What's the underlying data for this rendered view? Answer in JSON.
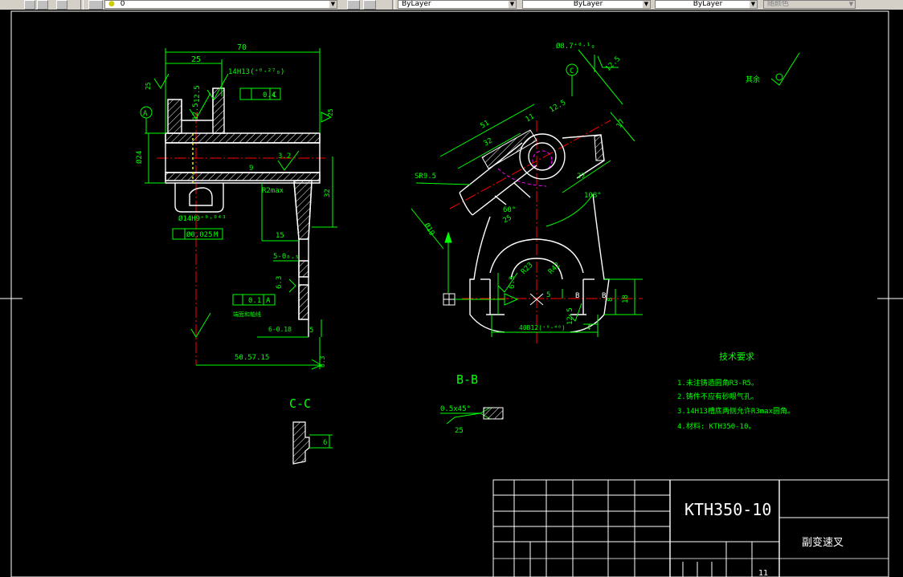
{
  "toolbar": {
    "layer_name": "0",
    "color": "ByLayer",
    "linetype": "ByLayer",
    "lineweight": "ByLayer",
    "plotstyle": "随颜色"
  },
  "drawing": {
    "left_view": {
      "dim_overall": "70",
      "dim_25": "25",
      "fit_14h13": "14H13(⁺⁰·²⁷₀)",
      "flatness_value": "0.4",
      "datum_c": "C",
      "datum_a": "A",
      "surf_12_5a": "12.5",
      "surf_12_5b": "12.5",
      "surf_3_2": "3.2",
      "dim_9": "9",
      "dia_24": "Ø24",
      "r2max": "R2max",
      "dim_32": "32",
      "bore": "Ø14H9⁺⁰·⁰⁴³",
      "position_tol": "Ø0.025",
      "modifier_m": "M",
      "dim_15": "15",
      "dim_5": "5-0₀.₅",
      "surf_6_3": "6.3",
      "perp_value": "0.1",
      "perp_datum": "A",
      "perp_note": "端面和轴线",
      "dim_6": "6-0.18",
      "dim_5b": "5",
      "dim_long": "50.57.15",
      "surf_6_3b": "6.3",
      "rough_25a": "25",
      "rough_25b": "25"
    },
    "right_view": {
      "dia_8_7": "Ø8.7⁺⁰·¹₀",
      "datum_c": "C",
      "rough_12_5": "12.5",
      "rough_12_5b": "12.5",
      "dim_51": "51",
      "dim_32": "32",
      "dim_11": "11",
      "dim_17": "17",
      "dim_27": "27",
      "angle_108": "108°",
      "sr9_5": "SR9.5",
      "dia_19": "Ø19",
      "angle_60": "60°",
      "dim_25": "25",
      "r23": "R23",
      "r42": "R42",
      "dim_5": "5",
      "section_b1": "B",
      "section_b2": "B",
      "dim_18": "18",
      "dim_8": "8",
      "dim_40": "40B12(⁺⁰·⁴⁸)",
      "dim_4": "4",
      "rough_12_5c": "12.5",
      "rough_6_3": "6.3"
    },
    "corner_rough": {
      "label": "其余",
      "value": ""
    },
    "section_bb": {
      "title": "B-B",
      "chamfer": "0.5x45°",
      "rough": "25"
    },
    "section_cc": {
      "title": "C-C",
      "dim_6": "6"
    },
    "tech_req": {
      "title": "技术要求",
      "lines": [
        "1.未注铸造圆角R3-R5。",
        "2.铸件不应有砂眼气孔。",
        "3.14H13槽底两侧允许R3max圆角。",
        "4.材料: KTH350-10。"
      ]
    },
    "title_block": {
      "material": "KTH350-10",
      "part_name": "副变速叉",
      "sheet": "11"
    }
  },
  "colors": {
    "background": "#000000",
    "outline": "#ffffff",
    "dimension": "#00ff00",
    "center": "#ff0000",
    "hidden": "#ff00ff",
    "accent": "#ffff00"
  }
}
